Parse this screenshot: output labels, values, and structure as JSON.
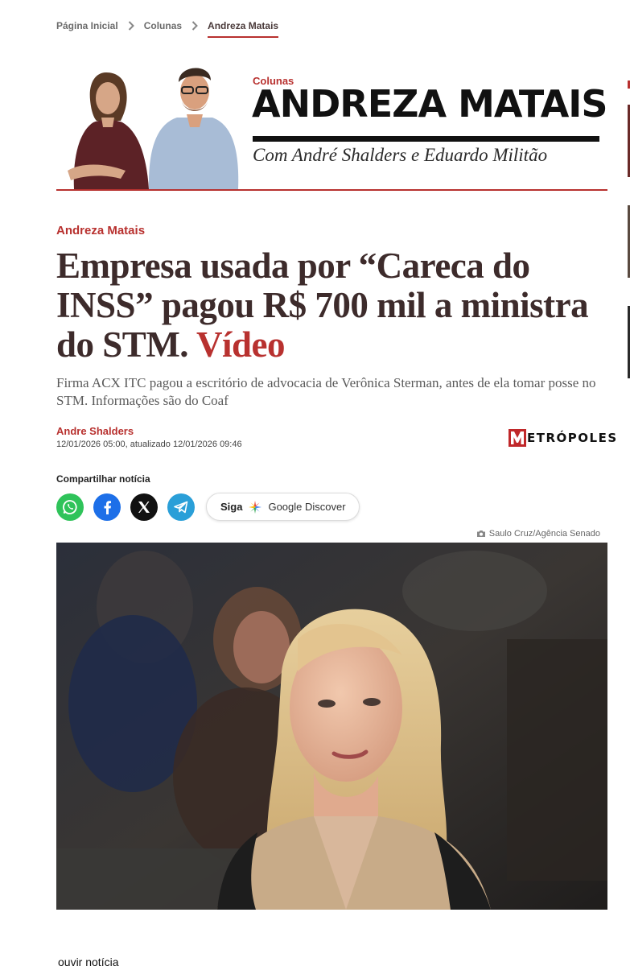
{
  "breadcrumb": {
    "items": [
      "Página Inicial",
      "Colunas",
      "Andreza Matais"
    ]
  },
  "column": {
    "kicker": "Colunas",
    "name": "ANDREZA MATAIS",
    "subtitle": "Com André Shalders e Eduardo Militão"
  },
  "article": {
    "section": "Andreza Matais",
    "headline": "Empresa usada por “Careca do INSS” pagou R$ 700 mil a ministra do STM.",
    "headline_tag": "Vídeo",
    "subtitle": "Firma ACX ITC pagou a escritório de advocacia de Verônica Sterman, antes de ela tomar posse no STM. Informações são do Coaf",
    "author": "Andre Shalders",
    "dates": "12/01/2026 05:00, atualizado 12/01/2026 09:46",
    "brand": "ETRÓPOLES",
    "photo_credit": "Saulo Cruz/Agência Senado",
    "listen": "ouvir notícia"
  },
  "share": {
    "title": "Compartilhar notícia",
    "follow_prefix": "Siga",
    "follow_label": "Google Discover"
  },
  "colors": {
    "accent": "#b8312f",
    "headline": "#3d2b2b",
    "whatsapp": "#2fc35a",
    "facebook": "#1d6fe8",
    "x": "#111111",
    "telegram": "#2a9fd8"
  }
}
